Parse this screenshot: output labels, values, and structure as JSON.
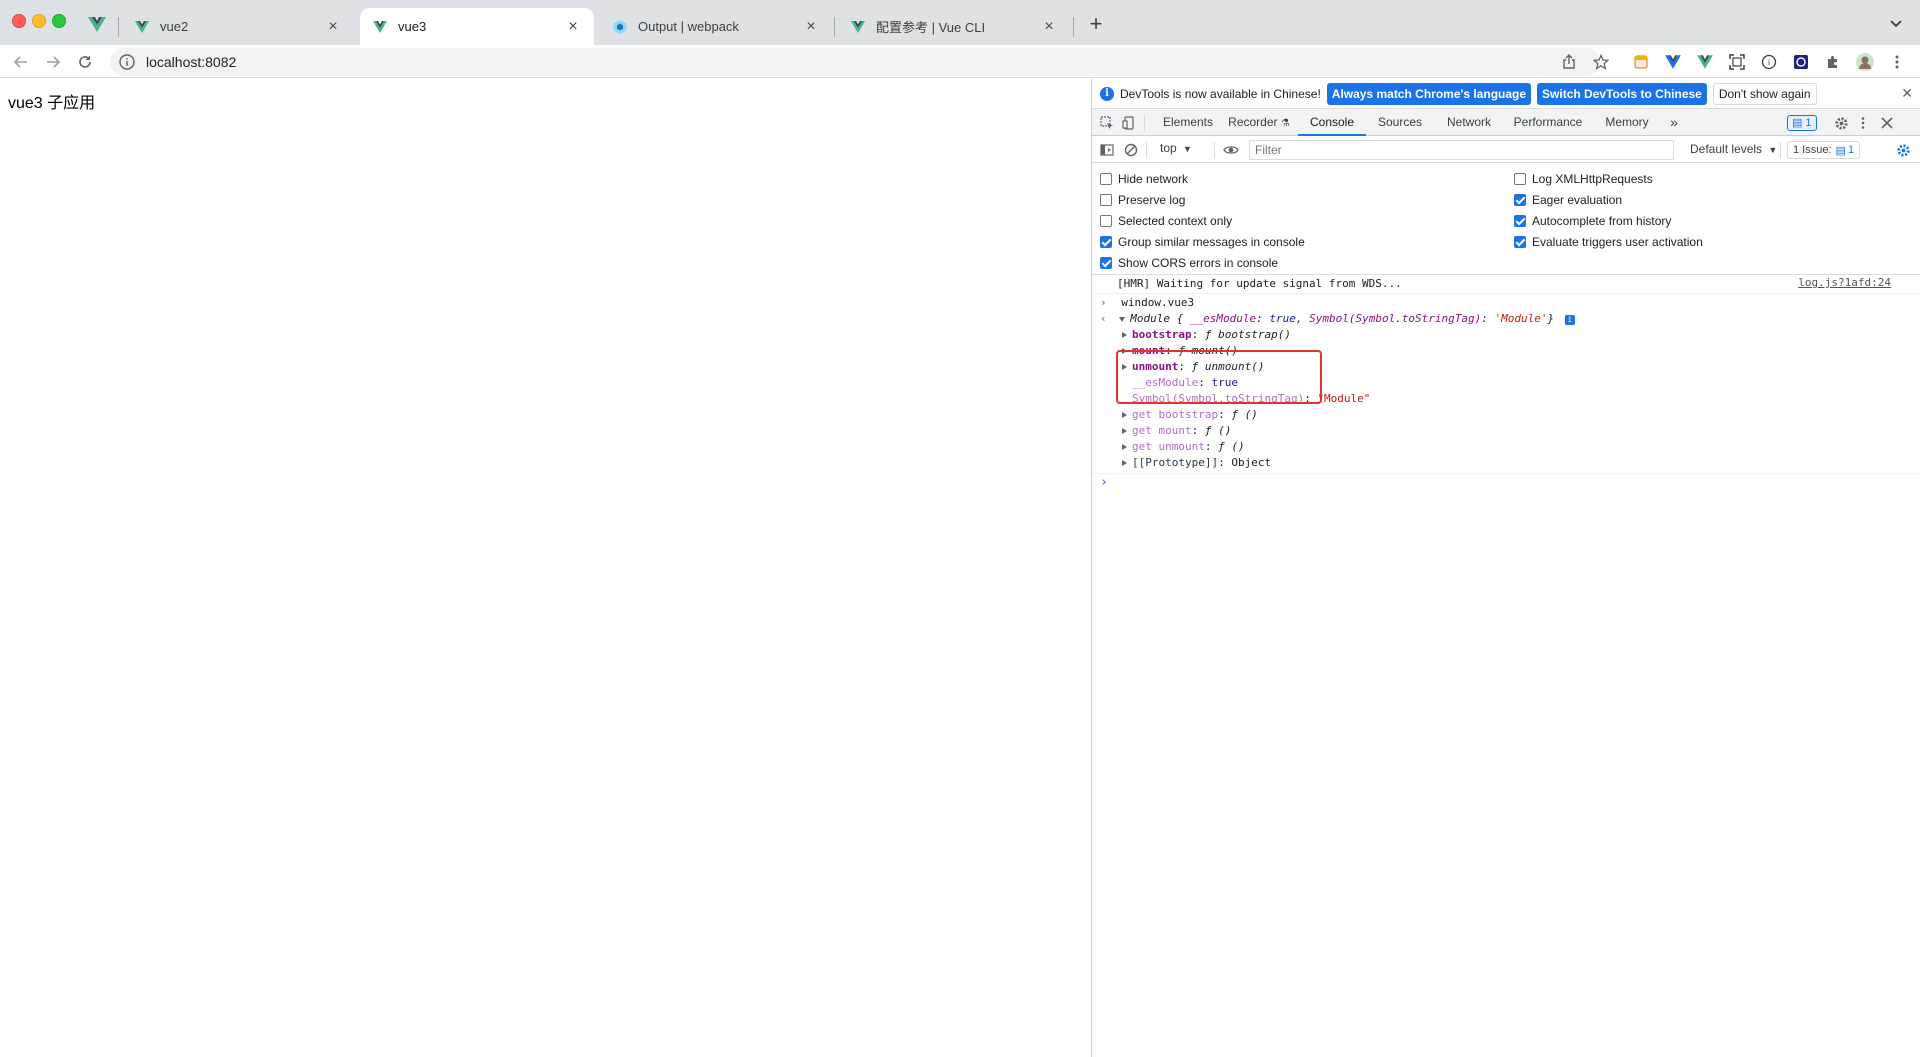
{
  "tabs": [
    {
      "title": "vue2",
      "active": false
    },
    {
      "title": "vue3",
      "active": true
    },
    {
      "title": "Output | webpack",
      "active": false
    },
    {
      "title": "配置参考 | Vue CLI",
      "active": false
    }
  ],
  "toolbar": {
    "url": "localhost:8082"
  },
  "page": {
    "heading": "vue3 子应用"
  },
  "devtools": {
    "infobar": {
      "message": "DevTools is now available in Chinese!",
      "btn_match": "Always match Chrome's language",
      "btn_switch": "Switch DevTools to Chinese",
      "btn_dont": "Don't show again"
    },
    "panel_tabs": [
      "Elements",
      "Recorder",
      "Console",
      "Sources",
      "Network",
      "Performance",
      "Memory"
    ],
    "active_panel": "Console",
    "message_badge": "1",
    "console_bar": {
      "context": "top",
      "filter_placeholder": "Filter",
      "levels": "Default levels",
      "issues_label": "1 Issue:",
      "issues_count": "1"
    },
    "settings": [
      {
        "label": "Hide network",
        "checked": false
      },
      {
        "label": "Preserve log",
        "checked": false
      },
      {
        "label": "Selected context only",
        "checked": false
      },
      {
        "label": "Group similar messages in console",
        "checked": true
      },
      {
        "label": "Show CORS errors in console",
        "checked": true
      },
      {
        "label": "Log XMLHttpRequests",
        "checked": false
      },
      {
        "label": "Eager evaluation",
        "checked": true
      },
      {
        "label": "Autocomplete from history",
        "checked": true
      },
      {
        "label": "Evaluate triggers user activation",
        "checked": true
      }
    ],
    "console": {
      "hmr_message": "[HMR] Waiting for update signal from WDS...",
      "hmr_source": "log.js?1afd:24",
      "input_cmd": "window.vue3",
      "module_summary_prefix": "Module {",
      "module_summary_key1": "__esModule",
      "module_summary_val1": "true",
      "module_summary_key2": "Symbol(Symbol.toStringTag)",
      "module_summary_val2": "'Module'",
      "module_summary_suffix": "}",
      "props": [
        {
          "key": "bootstrap",
          "value": "ƒ bootstrap()"
        },
        {
          "key": "mount",
          "value": "ƒ mount()"
        },
        {
          "key": "unmount",
          "value": "ƒ unmount()"
        }
      ],
      "esmodule_key": "__esModule",
      "esmodule_val": "true",
      "symbol_key": "Symbol(Symbol.toStringTag)",
      "symbol_val": "\"Module\"",
      "getters": [
        {
          "key": "get bootstrap",
          "value": "ƒ ()"
        },
        {
          "key": "get mount",
          "value": "ƒ ()"
        },
        {
          "key": "get unmount",
          "value": "ƒ ()"
        }
      ],
      "proto_key": "[[Prototype]]",
      "proto_val": "Object"
    }
  }
}
